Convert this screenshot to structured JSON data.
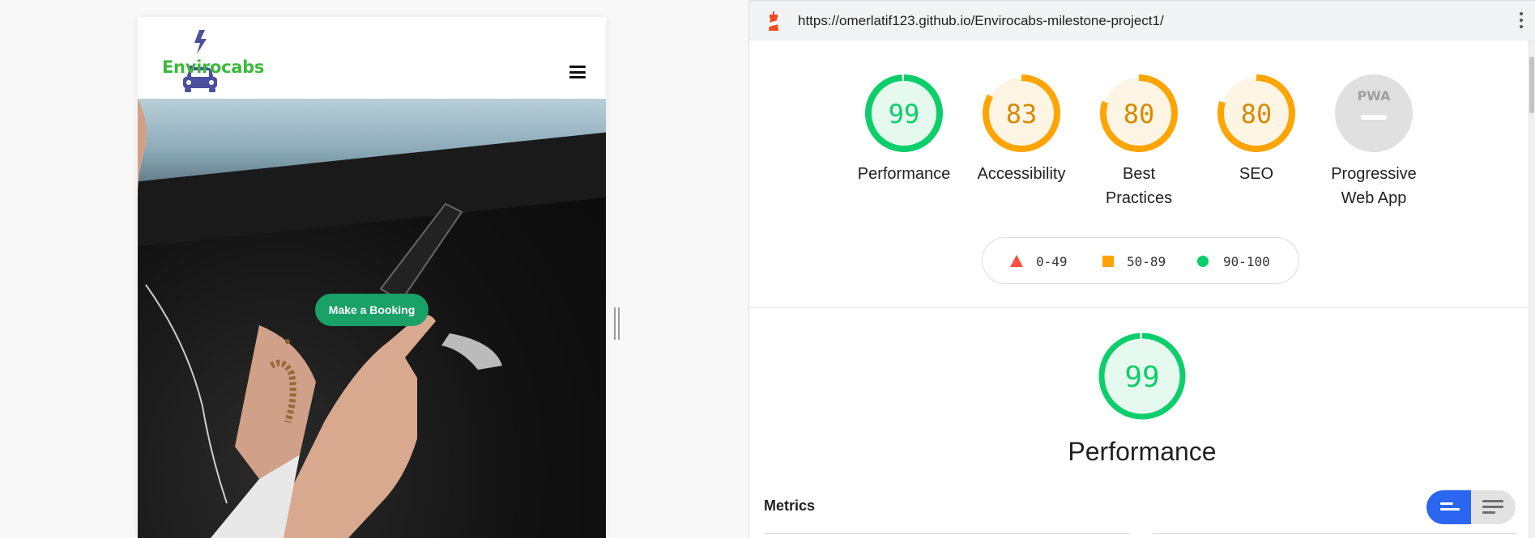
{
  "preview": {
    "brand": "Envirocabs",
    "cta_button": "Make a Booking"
  },
  "report": {
    "url": "https://omerlatif123.github.io/Envirocabs-milestone-project1/",
    "gauges": [
      {
        "score": "99",
        "label": "Performance",
        "status": "pass",
        "color": "#0cce6b",
        "fill": "#e6f9ee",
        "fraction": 0.99
      },
      {
        "score": "83",
        "label": "Accessibility",
        "status": "average",
        "color": "#ffa400",
        "fill": "#fff5e5",
        "fraction": 0.83
      },
      {
        "score": "80",
        "label_line1": "Best",
        "label_line2": "Practices",
        "status": "average",
        "color": "#ffa400",
        "fill": "#fff5e5",
        "fraction": 0.8
      },
      {
        "score": "80",
        "label": "SEO",
        "status": "average",
        "color": "#ffa400",
        "fill": "#fff5e5",
        "fraction": 0.8
      },
      {
        "badge": "PWA",
        "label_line1": "Progressive",
        "label_line2": "Web App",
        "status": "not-applicable"
      }
    ],
    "legend": [
      {
        "range": "0-49",
        "shape": "triangle",
        "color": "#ff4e42"
      },
      {
        "range": "50-89",
        "shape": "square",
        "color": "#ffa400"
      },
      {
        "range": "90-100",
        "shape": "circle",
        "color": "#0cce6b"
      }
    ],
    "performance": {
      "score": "99",
      "fraction": 0.99,
      "title": "Performance",
      "color": "#0cce6b"
    },
    "metrics_label": "Metrics",
    "icons": [
      "lighthouse-icon",
      "kebab-menu-icon",
      "hamburger-menu-icon",
      "taxi-icon",
      "lightning-icon"
    ]
  }
}
